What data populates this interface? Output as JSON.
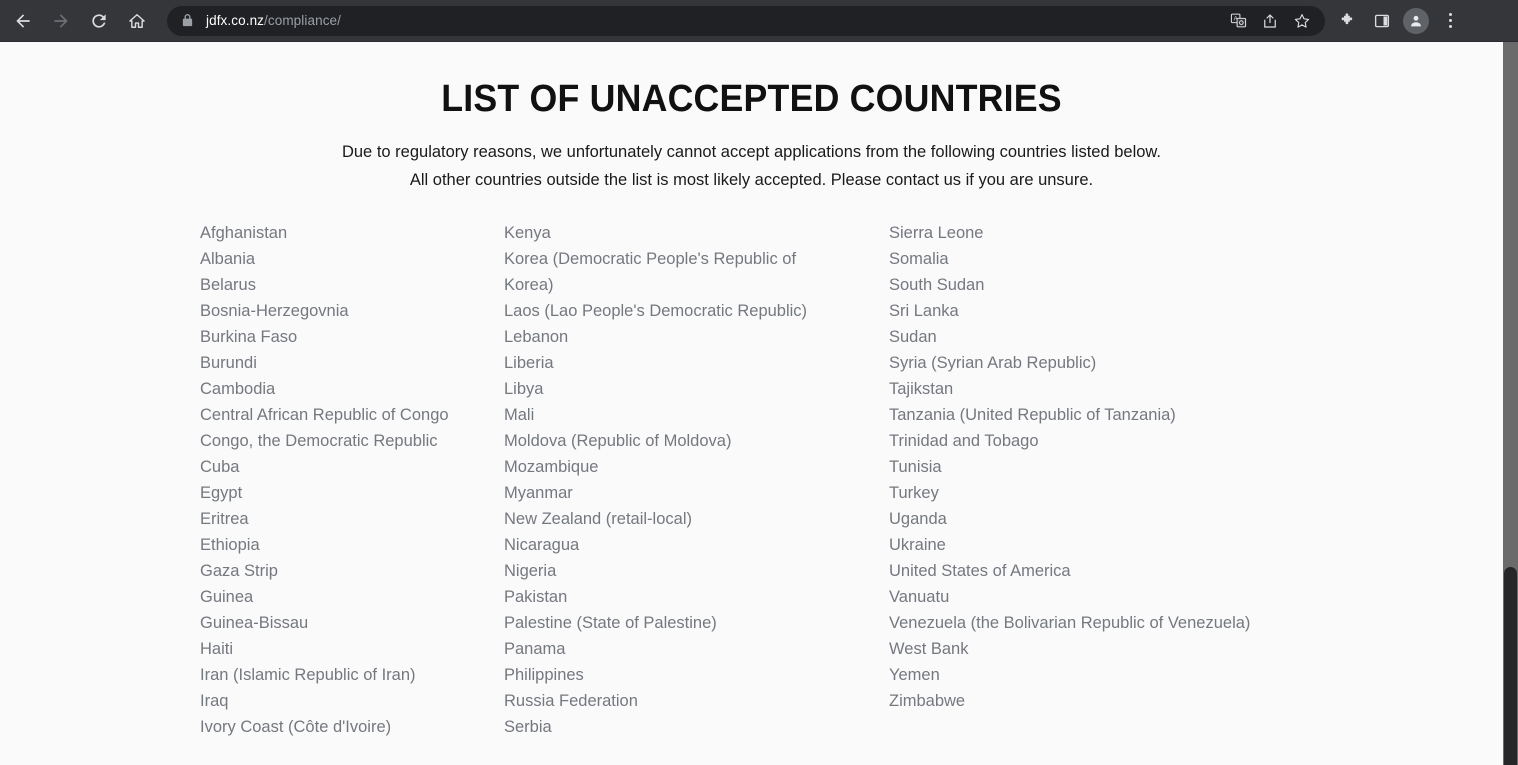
{
  "browser": {
    "back_label": "Back",
    "forward_label": "Forward",
    "reload_label": "Reload",
    "home_label": "Home",
    "url_domain": "jdfx.co.nz",
    "url_path": "/compliance/",
    "secure_icon": "lock-icon",
    "toolbar_icons": [
      "translate-icon",
      "share-icon",
      "bookmark-star-icon",
      "extensions-puzzle-icon",
      "side-panel-icon",
      "profile-avatar-icon",
      "three-dot-menu-icon"
    ],
    "theme_colors": {
      "toolbar_bg": "#35363a",
      "omnibox_bg": "#202124",
      "icon_fg": "#dadce0",
      "url_domain_fg": "#ffffff",
      "url_path_fg": "#9aa0a6"
    }
  },
  "page": {
    "background": "#fafafa",
    "title": "LIST OF UNACCEPTED COUNTRIES",
    "subtitle_line_1": "Due to regulatory reasons, we unfortunately cannot accept applications from the following countries listed below.",
    "subtitle_line_2": "All other countries outside the list is most likely accepted. Please contact us if you are unsure.",
    "title_color": "#111111",
    "subtitle_color": "#1a1a1a",
    "list_text_color": "#74787f"
  },
  "countries": {
    "column_1": [
      "Afghanistan",
      "Albania",
      "Belarus",
      "Bosnia-Herzegovnia",
      "Burkina Faso",
      "Burundi",
      "Cambodia",
      "Central African Republic of Congo",
      "Congo, the Democratic Republic",
      "Cuba",
      "Egypt",
      "Eritrea",
      "Ethiopia",
      "Gaza Strip",
      "Guinea",
      "Guinea-Bissau",
      "Haiti",
      "Iran (Islamic Republic of Iran)",
      "Iraq",
      "Ivory Coast (Côte d'Ivoire)"
    ],
    "column_2": [
      "Kenya",
      "Korea (Democratic People's Republic of Korea)",
      "Laos (Lao People's Democratic Republic)",
      "Lebanon",
      "Liberia",
      "Libya",
      "Mali",
      "Moldova (Republic of Moldova)",
      "Mozambique",
      "Myanmar",
      "New Zealand (retail-local)",
      "Nicaragua",
      "Nigeria",
      "Pakistan",
      "Palestine (State of Palestine)",
      "Panama",
      "Philippines",
      "Russia Federation",
      "Serbia"
    ],
    "column_3": [
      "Sierra Leone",
      "Somalia",
      "South Sudan",
      "Sri Lanka",
      "Sudan",
      "Syria (Syrian Arab Republic)",
      "Tajikstan",
      "Tanzania (United Republic of Tanzania)",
      "Trinidad and Tobago",
      "Tunisia",
      "Turkey",
      "Uganda",
      "Ukraine",
      "United States of America",
      "Vanuatu",
      "Venezuela (the Bolivarian Republic of Venezuela)",
      "West Bank",
      "Yemen",
      "Zimbabwe"
    ]
  },
  "scrollbar": {
    "track_color": "#6b6b6b",
    "thumb_color": "#262628",
    "orientation": "vertical"
  }
}
